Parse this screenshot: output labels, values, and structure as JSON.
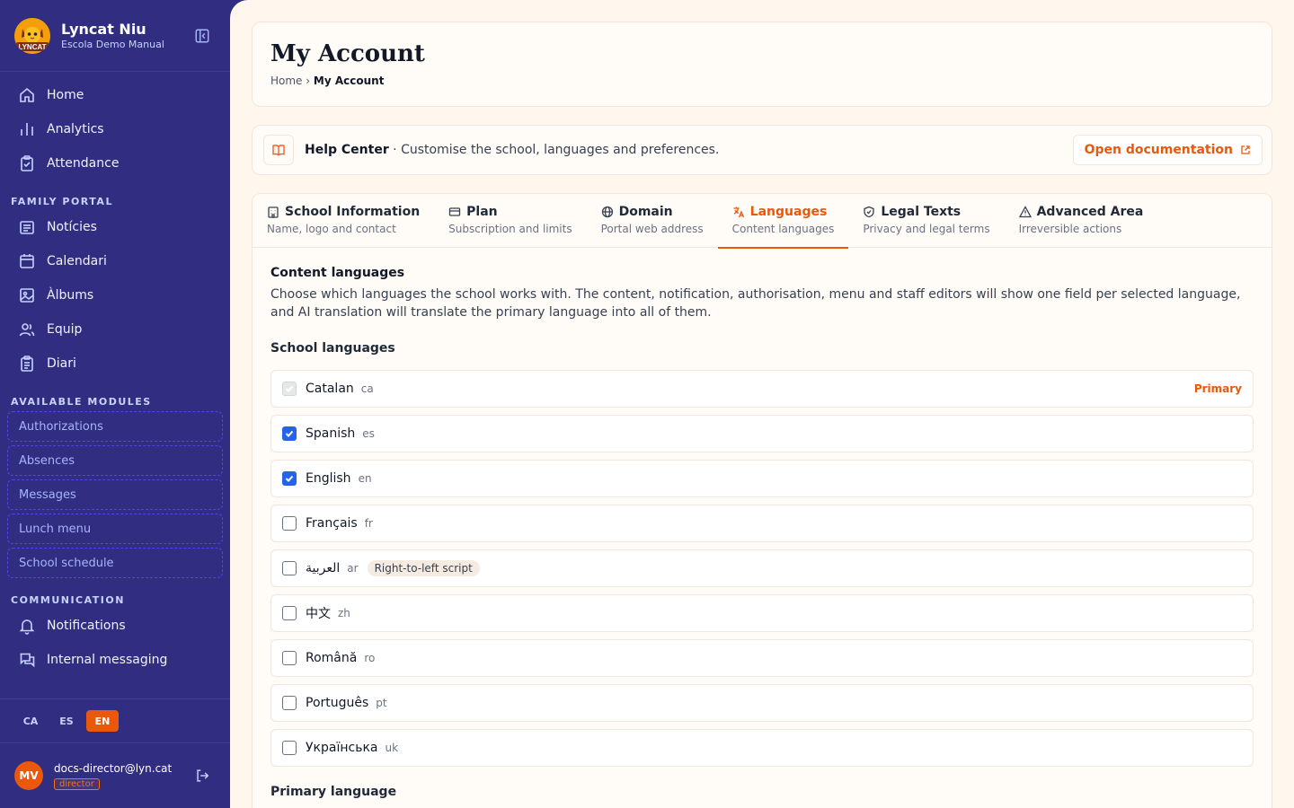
{
  "sidebar": {
    "brand_name": "Lyncat Niu",
    "brand_sub": "Escola Demo Manual",
    "logo_text": "LYNCAT",
    "main_items": [
      {
        "label": "Home"
      },
      {
        "label": "Analytics"
      },
      {
        "label": "Attendance"
      }
    ],
    "family_portal_label": "FAMILY PORTAL",
    "family_items": [
      {
        "label": "Notícies"
      },
      {
        "label": "Calendari"
      },
      {
        "label": "Àlbums"
      },
      {
        "label": "Equip"
      },
      {
        "label": "Diari"
      }
    ],
    "modules_label": "AVAILABLE MODULES",
    "modules": [
      {
        "label": "Authorizations"
      },
      {
        "label": "Absences"
      },
      {
        "label": "Messages"
      },
      {
        "label": "Lunch menu"
      },
      {
        "label": "School schedule"
      }
    ],
    "communication_label": "COMMUNICATION",
    "communication_items": [
      {
        "label": "Notifications"
      },
      {
        "label": "Internal messaging"
      }
    ],
    "languages": [
      "CA",
      "ES",
      "EN"
    ],
    "active_language": "EN",
    "user_initials": "MV",
    "user_email": "docs-director@lyn.cat",
    "user_role": "director"
  },
  "header": {
    "title": "My Account",
    "breadcrumb_home": "Home",
    "breadcrumb_sep": "›",
    "breadcrumb_current": "My Account"
  },
  "help": {
    "title": "Help Center",
    "text": " · Customise the school, languages and preferences.",
    "button": "Open documentation"
  },
  "tabs": [
    {
      "title": "School Information",
      "sub": "Name, logo and contact",
      "icon": "building-icon"
    },
    {
      "title": "Plan",
      "sub": "Subscription and limits",
      "icon": "credit-card-icon"
    },
    {
      "title": "Domain",
      "sub": "Portal web address",
      "icon": "globe-icon"
    },
    {
      "title": "Languages",
      "sub": "Content languages",
      "icon": "translate-icon",
      "active": true
    },
    {
      "title": "Legal Texts",
      "sub": "Privacy and legal terms",
      "icon": "shield-icon"
    },
    {
      "title": "Advanced Area",
      "sub": "Irreversible actions",
      "icon": "warning-icon"
    }
  ],
  "panel": {
    "heading": "Content languages",
    "description": "Choose which languages the school works with. The content, notification, authorisation, menu and staff editors will show one field per selected language, and AI translation will translate the primary language into all of them.",
    "school_languages_label": "School languages",
    "primary_label": "Primary",
    "rtl_label": "Right-to-left script",
    "primary_language_label": "Primary language",
    "languages": [
      {
        "name": "Catalan",
        "code": "ca",
        "checked": true,
        "disabled": true,
        "primary": true
      },
      {
        "name": "Spanish",
        "code": "es",
        "checked": true
      },
      {
        "name": "English",
        "code": "en",
        "checked": true
      },
      {
        "name": "Français",
        "code": "fr",
        "checked": false
      },
      {
        "name": "العربية",
        "code": "ar",
        "checked": false,
        "rtl": true
      },
      {
        "name": "中文",
        "code": "zh",
        "checked": false
      },
      {
        "name": "Română",
        "code": "ro",
        "checked": false
      },
      {
        "name": "Português",
        "code": "pt",
        "checked": false
      },
      {
        "name": "Українська",
        "code": "uk",
        "checked": false
      }
    ]
  },
  "colors": {
    "sidebar_bg": "#312e81",
    "accent": "#ea580c",
    "checkbox": "#2563eb"
  }
}
